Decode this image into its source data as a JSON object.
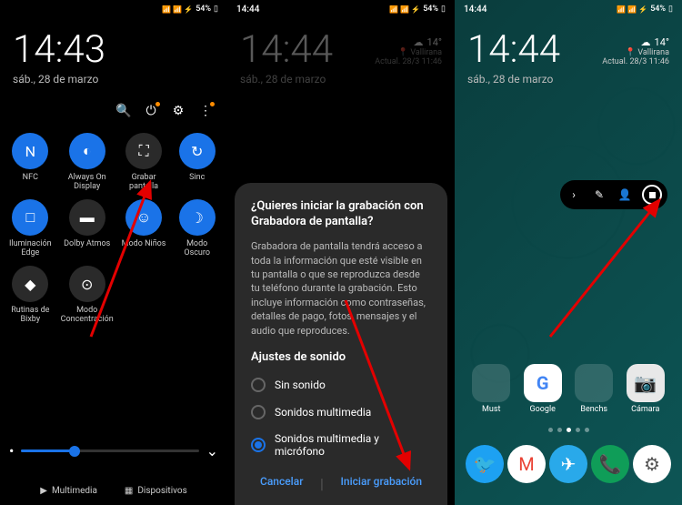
{
  "status": {
    "time_p1": "",
    "time_p2": "14:44",
    "time_p3": "14:44",
    "battery": "54%",
    "icons": "📶 📶"
  },
  "p1": {
    "time": "14:43",
    "date": "sáb., 28 de marzo",
    "tiles": [
      {
        "label": "NFC",
        "state": "on",
        "icon": "N"
      },
      {
        "label": "Always On Display",
        "state": "on",
        "icon": "◐"
      },
      {
        "label": "Grabar pantalla",
        "state": "off",
        "icon": "⛶"
      },
      {
        "label": "Sinc",
        "state": "on",
        "icon": "↻"
      },
      {
        "label": "Iluminación Edge",
        "state": "on",
        "icon": "□"
      },
      {
        "label": "Dolby Atmos",
        "state": "off",
        "icon": "▬"
      },
      {
        "label": "Modo Niños",
        "state": "on",
        "icon": "☺"
      },
      {
        "label": "Modo Oscuro",
        "state": "on",
        "icon": "☽"
      },
      {
        "label": "Rutinas de Bixby",
        "state": "off",
        "icon": "◆"
      },
      {
        "label": "Modo Concentración",
        "state": "off",
        "icon": "⊙"
      }
    ],
    "tabs": {
      "media": "Multimedia",
      "devices": "Dispositivos"
    }
  },
  "p2": {
    "time": "14:44",
    "date": "sáb., 28 de marzo",
    "weather": {
      "temp": "14°",
      "loc": "Vallirana",
      "updated": "Actual. 28/3 11:46"
    },
    "dialog": {
      "title": "¿Quieres iniciar la grabación con Grabadora de pantalla?",
      "body": "Grabadora de pantalla tendrá acceso a toda la información que esté visible en tu pantalla o que se reproduzca desde tu teléfono durante la grabación. Esto incluye información como contraseñas, detalles de pago, fotos, mensajes y el audio que reproduces.",
      "section": "Ajustes de sonido",
      "opts": [
        "Sin sonido",
        "Sonidos multimedia",
        "Sonidos multimedia y micrófono"
      ],
      "selected": 2,
      "cancel": "Cancelar",
      "confirm": "Iniciar grabación"
    }
  },
  "p3": {
    "time": "14:44",
    "date": "sáb., 28 de marzo",
    "weather": {
      "temp": "14°",
      "loc": "Vallirana",
      "updated": "Actual. 28/3 11:46"
    },
    "apps": [
      {
        "label": "Must",
        "type": "folder"
      },
      {
        "label": "Google",
        "bg": "#fff",
        "glyph": "G",
        "color": "#4285f4"
      },
      {
        "label": "Benchs",
        "type": "folder"
      },
      {
        "label": "Cámara",
        "bg": "#e8e8e8",
        "glyph": "📷"
      }
    ],
    "dock": [
      {
        "bg": "#1da1f2",
        "glyph": "🐦"
      },
      {
        "bg": "#fff",
        "glyph": "M",
        "color": "#ea4335"
      },
      {
        "bg": "#29a9ea",
        "glyph": "✈"
      },
      {
        "bg": "#0f9d58",
        "glyph": "📞"
      },
      {
        "bg": "#fff",
        "glyph": "⚙",
        "color": "#555"
      }
    ]
  }
}
